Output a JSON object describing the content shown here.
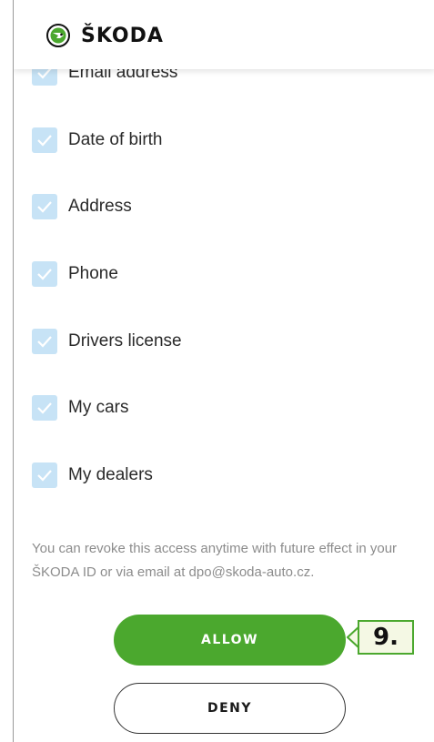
{
  "header": {
    "brand": "ŠKODA",
    "logo_icon": "skoda-winged-arrow-icon"
  },
  "permissions": [
    {
      "label": "Email address",
      "checked": true
    },
    {
      "label": "Date of birth",
      "checked": true
    },
    {
      "label": "Address",
      "checked": true
    },
    {
      "label": "Phone",
      "checked": true
    },
    {
      "label": "Drivers license",
      "checked": true
    },
    {
      "label": "My cars",
      "checked": true
    },
    {
      "label": "My dealers",
      "checked": true
    }
  ],
  "note": "You can revoke this access anytime with future effect in your ŠKODA ID or via email at dpo@skoda-auto.cz.",
  "buttons": {
    "allow": "ALLOW",
    "deny": "DENY"
  },
  "callout": {
    "label": "9."
  },
  "colors": {
    "brand_green": "#4ba82e",
    "checkbox_bg": "#c7e3f6",
    "text": "#2a2a2a",
    "muted_text": "#8c8c8c"
  }
}
